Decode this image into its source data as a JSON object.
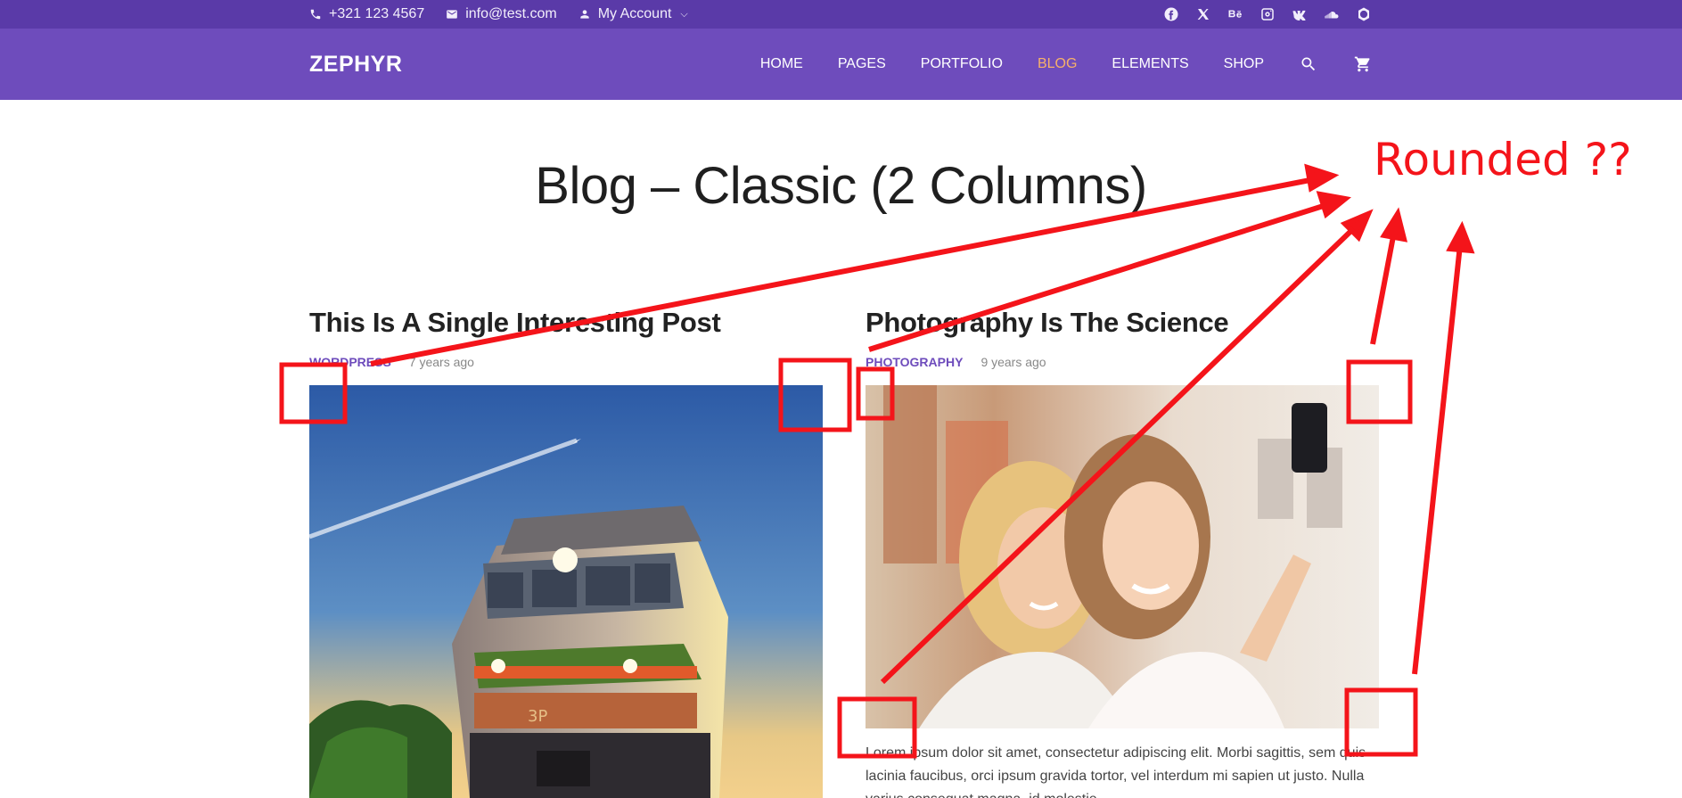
{
  "topbar": {
    "phone": "+321 123 4567",
    "email": "info@test.com",
    "account": "My Account",
    "socials": [
      "facebook-icon",
      "x-icon",
      "behance-icon",
      "instagram-icon",
      "vk-icon",
      "soundcloud-icon",
      "jsfiddle-icon"
    ]
  },
  "nav": {
    "logo": "ZEPHYR",
    "items": [
      {
        "label": "HOME"
      },
      {
        "label": "PAGES"
      },
      {
        "label": "PORTFOLIO"
      },
      {
        "label": "BLOG",
        "active": true
      },
      {
        "label": "ELEMENTS"
      },
      {
        "label": "SHOP"
      }
    ]
  },
  "page": {
    "title": "Blog – Classic (2 Columns)"
  },
  "posts": [
    {
      "title": "This Is A Single Interesting Post",
      "category": "WORDPRESS",
      "time": "7 years ago"
    },
    {
      "title": "Photography Is The Science",
      "category": "PHOTOGRAPHY",
      "time": "9 years ago",
      "excerpt": "Lorem ipsum dolor sit amet, consectetur adipiscing elit. Morbi sagittis, sem quis lacinia faucibus, orci ipsum gravida tortor, vel interdum mi sapien ut justo. Nulla varius consequat magna, id molestie"
    }
  ],
  "annotation": {
    "text": "Rounded ??"
  },
  "colors": {
    "topbar": "#5a3aa8",
    "nav": "#6e4cbc",
    "active_link": "#f7b16a",
    "category": "#6e4cbc",
    "annotation": "#f4141a"
  }
}
